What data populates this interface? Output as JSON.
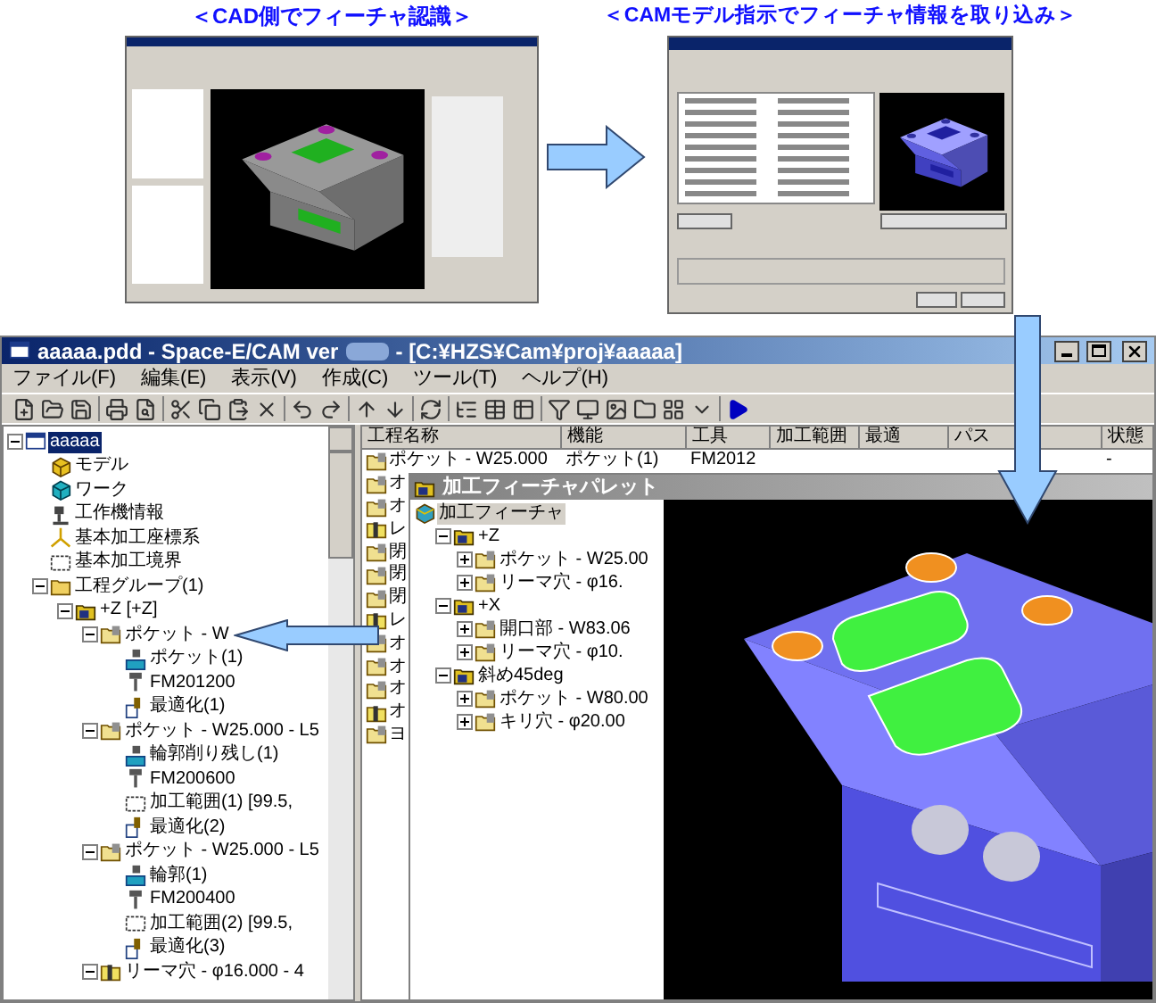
{
  "captions": [
    "＜CAD側でフィーチャ認識＞",
    "＜CAMモデル指示でフィーチャ情報を取り込み＞"
  ],
  "main_window": {
    "title": "aaaaa.pdd - Space-E/CAM ver",
    "title_path": "- [C:¥HZS¥Cam¥proj¥aaaaa]",
    "menu": [
      "ファイル(F)",
      "編集(E)",
      "表示(V)",
      "作成(C)",
      "ツール(T)",
      "ヘルプ(H)"
    ],
    "tree": [
      {
        "label": "aaaaa",
        "kind": "project",
        "selected": true,
        "expanded": true,
        "children": [
          {
            "label": "モデル",
            "kind": "model",
            "selected": false
          },
          {
            "label": "ワーク",
            "kind": "work",
            "selected": false
          },
          {
            "label": "工作機情報",
            "kind": "machine",
            "selected": false
          },
          {
            "label": "基本加工座標系",
            "kind": "axes",
            "selected": false
          },
          {
            "label": "基本加工境界",
            "kind": "boundary",
            "selected": false
          },
          {
            "label": "工程グループ(1)",
            "kind": "group",
            "selected": false,
            "expanded": true,
            "children": [
              {
                "label": "+Z [+Z]",
                "kind": "setup",
                "selected": false,
                "expanded": true,
                "children": [
                  {
                    "label": "ポケット - W",
                    "kind": "feature",
                    "selected": false,
                    "expanded": true,
                    "children": [
                      {
                        "label": "ポケット(1)",
                        "kind": "machining",
                        "selected": false
                      },
                      {
                        "label": "FM201200",
                        "kind": "tool",
                        "selected": false
                      },
                      {
                        "label": "最適化(1)",
                        "kind": "optimize",
                        "selected": false
                      }
                    ]
                  },
                  {
                    "label": "ポケット - W25.000 - L5",
                    "kind": "feature",
                    "selected": false,
                    "expanded": true,
                    "children": [
                      {
                        "label": "輪郭削り残し(1)",
                        "kind": "machining",
                        "selected": false
                      },
                      {
                        "label": "FM200600",
                        "kind": "tool",
                        "selected": false
                      },
                      {
                        "label": "加工範囲(1) [99.5,",
                        "kind": "range",
                        "selected": false
                      },
                      {
                        "label": "最適化(2)",
                        "kind": "optimize",
                        "selected": false
                      }
                    ]
                  },
                  {
                    "label": "ポケット - W25.000 - L5",
                    "kind": "feature",
                    "selected": false,
                    "expanded": true,
                    "children": [
                      {
                        "label": "輪郭(1)",
                        "kind": "machining",
                        "selected": false
                      },
                      {
                        "label": "FM200400",
                        "kind": "tool",
                        "selected": false
                      },
                      {
                        "label": "加工範囲(2) [99.5,",
                        "kind": "range",
                        "selected": false
                      },
                      {
                        "label": "最適化(3)",
                        "kind": "optimize",
                        "selected": false
                      }
                    ]
                  },
                  {
                    "label": "リーマ穴 - φ16.000 - 4",
                    "kind": "hole",
                    "selected": false,
                    "expanded": true
                  }
                ]
              }
            ]
          }
        ]
      }
    ],
    "list": {
      "columns": [
        "工程名称",
        "機能",
        "工具",
        "加工範囲",
        "最適",
        "パス",
        "状態"
      ],
      "rows": [
        {
          "cells": [
            "ポケット - W25.000",
            "ポケット(1)",
            "FM2012",
            "",
            "",
            "",
            "-"
          ]
        },
        {
          "cells": [
            "オ"
          ]
        },
        {
          "cells": [
            "オ"
          ]
        },
        {
          "cells": [
            "レ"
          ]
        },
        {
          "cells": [
            "閉"
          ]
        },
        {
          "cells": [
            "閉"
          ]
        },
        {
          "cells": [
            "閉"
          ]
        },
        {
          "cells": [
            "レ"
          ]
        },
        {
          "cells": [
            "オ"
          ]
        },
        {
          "cells": [
            "オ"
          ]
        },
        {
          "cells": [
            "オ"
          ]
        },
        {
          "cells": [
            "オ"
          ]
        },
        {
          "cells": [
            "ヨ"
          ]
        }
      ]
    },
    "palette": {
      "title": "加工フィーチャパレット",
      "tree": [
        {
          "label": "加工フィーチャ",
          "kind": "root",
          "selected": true,
          "children": [
            {
              "label": "+Z",
              "kind": "setup",
              "selected": false,
              "expanded": true,
              "children": [
                {
                  "label": "ポケット - W25.00",
                  "kind": "feature",
                  "selected": false,
                  "expanded": false
                },
                {
                  "label": "リーマ穴 - φ16.",
                  "kind": "feature",
                  "selected": false,
                  "expanded": false
                }
              ]
            },
            {
              "label": "+X",
              "kind": "setup",
              "selected": false,
              "expanded": true,
              "children": [
                {
                  "label": "開口部 - W83.06",
                  "kind": "feature",
                  "selected": false,
                  "expanded": false
                },
                {
                  "label": "リーマ穴 - φ10.",
                  "kind": "feature",
                  "selected": false,
                  "expanded": false
                }
              ]
            },
            {
              "label": "斜め45deg",
              "kind": "setup",
              "selected": false,
              "expanded": true,
              "children": [
                {
                  "label": "ポケット - W80.00",
                  "kind": "feature",
                  "selected": false,
                  "expanded": false
                },
                {
                  "label": "キリ穴 - φ20.00",
                  "kind": "feature",
                  "selected": false,
                  "expanded": false
                }
              ]
            }
          ]
        }
      ]
    }
  }
}
